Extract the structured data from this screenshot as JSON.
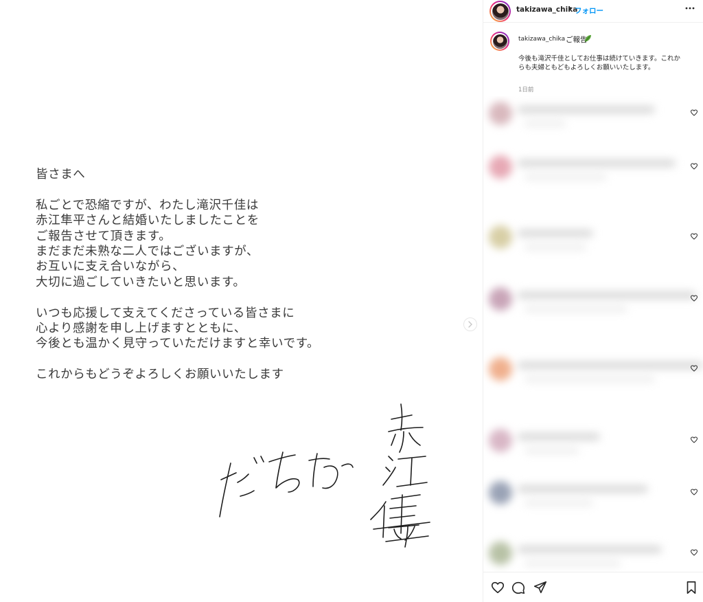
{
  "post": {
    "letter_lines": [
      "皆さまへ",
      "",
      "私ごとで恐縮ですが、わたし滝沢千佳は",
      "赤江隼平さんと結婚いたしましたことを",
      "ご報告させて頂きます。",
      "まだまだ未熟な二人ではございますが、",
      "お互いに支え合いながら、",
      "大切に過ごしていきたいと思います。",
      "",
      "いつも応援して支えてくださっている皆さまに",
      "心より感謝を申し上げますとともに、",
      "今後とも温かく見守っていただけますと幸いです。",
      "",
      "これからもどうぞよろしくお願いいたします"
    ],
    "signature_text": "たきざわ ちか / 赤江隼平",
    "next_icon": "chevron-right-icon"
  },
  "header": {
    "username": "takizawa_chika",
    "separator": "•",
    "follow_label": "フォロー",
    "more_icon": "more-horizontal-icon"
  },
  "caption": {
    "username": "takizawa_chika",
    "title": "ご報告",
    "emoji": "leaf-icon",
    "body": "今後も滝沢千佳としてお仕事は続けていきます。これからも夫婦ともどもよろしくお願いいたします。",
    "time": "1日前"
  },
  "comments": [
    {
      "avatar_color": "#d9b9be"
    },
    {
      "avatar_color": "#e7a9b5"
    },
    {
      "avatar_color": "#d8cfa6"
    },
    {
      "avatar_color": "#c9a5b8"
    },
    {
      "avatar_color": "#f0b08e"
    },
    {
      "avatar_color": "#d9b7c6"
    },
    {
      "avatar_color": "#9aa3b6"
    },
    {
      "avatar_color": "#b8c2a6"
    }
  ],
  "actions": {
    "like_icon": "heart-icon",
    "comment_icon": "comment-icon",
    "share_icon": "share-icon",
    "save_icon": "bookmark-icon"
  },
  "colors": {
    "accent": "#0095f6",
    "text": "#262626",
    "muted": "#8e8e8e",
    "border": "#efefef"
  }
}
